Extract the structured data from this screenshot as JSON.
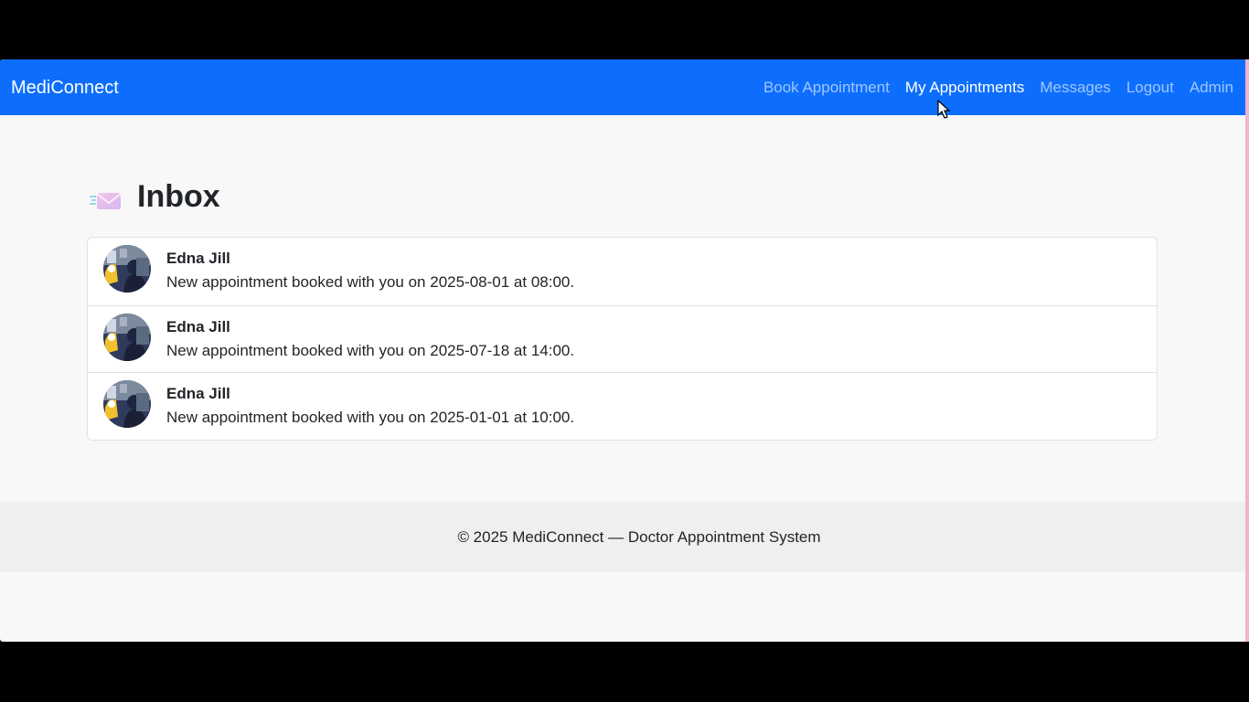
{
  "navbar": {
    "brand": "MediConnect",
    "links": [
      {
        "label": "Book Appointment",
        "active": false
      },
      {
        "label": "My Appointments",
        "active": true
      },
      {
        "label": "Messages",
        "active": false
      },
      {
        "label": "Logout",
        "active": false
      },
      {
        "label": "Admin",
        "active": false
      }
    ],
    "background_color": "#0d6efd"
  },
  "page": {
    "title": "Inbox",
    "title_icon": "envelope-icon"
  },
  "messages": [
    {
      "sender": "Edna Jill",
      "text": "New appointment booked with you on 2025-08-01 at 08:00.",
      "avatar": "avatar-photo"
    },
    {
      "sender": "Edna Jill",
      "text": "New appointment booked with you on 2025-07-18 at 14:00.",
      "avatar": "avatar-photo"
    },
    {
      "sender": "Edna Jill",
      "text": "New appointment booked with you on 2025-01-01 at 10:00.",
      "avatar": "avatar-photo"
    }
  ],
  "footer": {
    "text": "© 2025 MediConnect — Doctor Appointment System"
  }
}
